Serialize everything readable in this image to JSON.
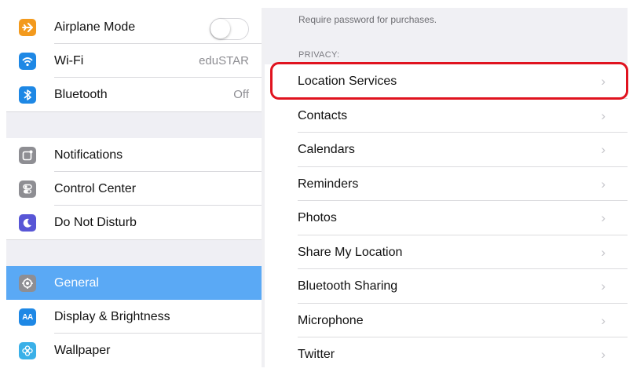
{
  "sidebar": {
    "airplane": {
      "label": "Airplane Mode",
      "icon": "airplane-icon",
      "color": "#f39a1d"
    },
    "wifi": {
      "label": "Wi-Fi",
      "value": "eduSTAR",
      "icon": "wifi-icon",
      "color": "#1e88e5"
    },
    "bluetooth": {
      "label": "Bluetooth",
      "value": "Off",
      "icon": "bluetooth-icon",
      "color": "#1e88e5"
    },
    "notifications": {
      "label": "Notifications",
      "icon": "notifications-icon",
      "color": "#8e8e93"
    },
    "control_center": {
      "label": "Control Center",
      "icon": "control-center-icon",
      "color": "#8e8e93"
    },
    "do_not_disturb": {
      "label": "Do Not Disturb",
      "icon": "moon-icon",
      "color": "#5856d6"
    },
    "general": {
      "label": "General",
      "icon": "gear-icon",
      "color": "#8e8e93",
      "selected": true
    },
    "display": {
      "label": "Display & Brightness",
      "icon": "display-icon",
      "color": "#1e88e5",
      "glyph": "AA"
    },
    "wallpaper": {
      "label": "Wallpaper",
      "icon": "wallpaper-icon",
      "color": "#3ab0e8"
    }
  },
  "panel": {
    "note": "Require password for purchases.",
    "section": "PRIVACY:",
    "items": [
      {
        "label": "Location Services"
      },
      {
        "label": "Contacts"
      },
      {
        "label": "Calendars"
      },
      {
        "label": "Reminders"
      },
      {
        "label": "Photos"
      },
      {
        "label": "Share My Location"
      },
      {
        "label": "Bluetooth Sharing"
      },
      {
        "label": "Microphone"
      },
      {
        "label": "Twitter"
      }
    ],
    "chevron": "›"
  },
  "colors": {
    "highlight": "#e0131f",
    "selected_row": "#5aa9f5"
  }
}
